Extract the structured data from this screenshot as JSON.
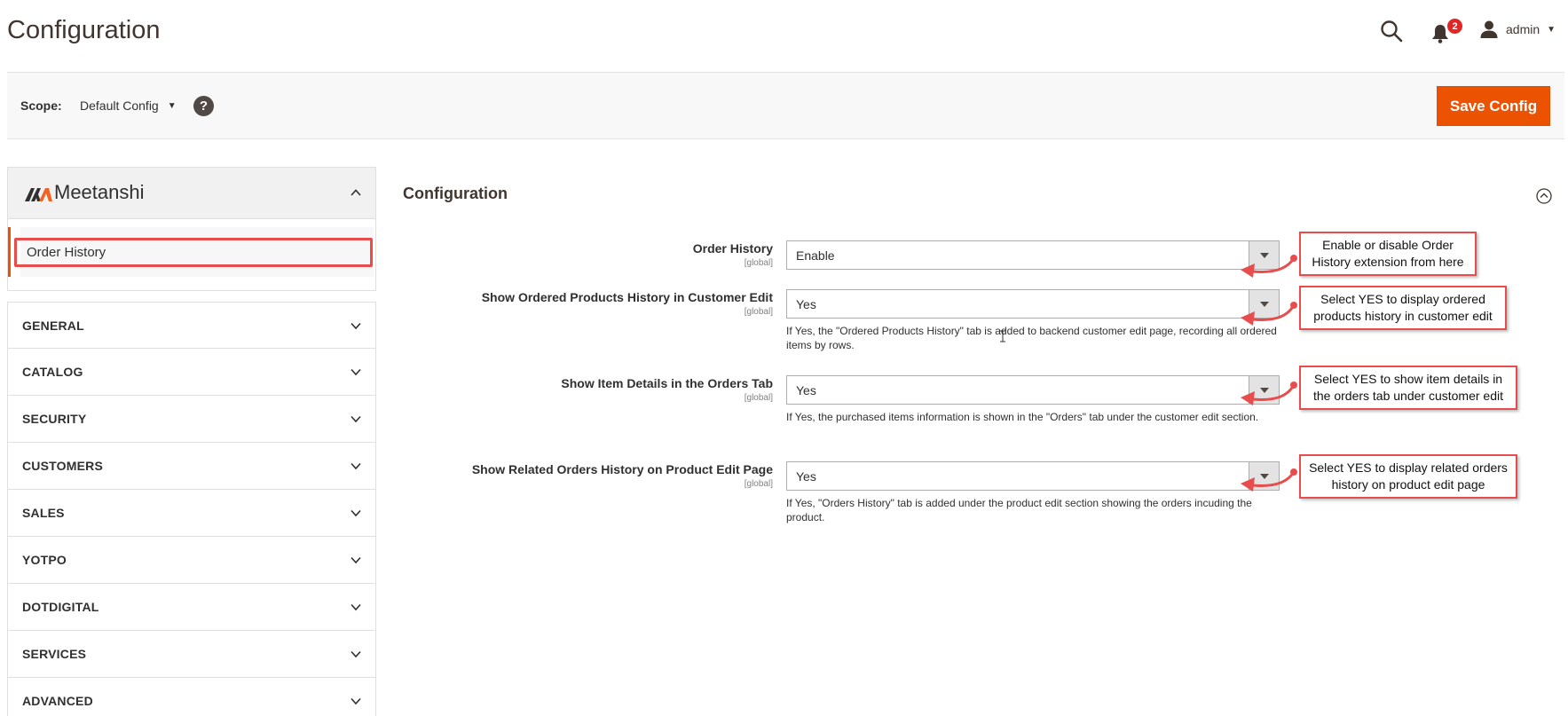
{
  "header": {
    "title": "Configuration",
    "notification_count": "2",
    "user_name": "admin"
  },
  "scope_bar": {
    "label": "Scope:",
    "selected": "Default Config",
    "help": "?",
    "save_label": "Save Config"
  },
  "sidebar": {
    "brand": "Meetanshi",
    "sub_item": "Order History",
    "sections": [
      "GENERAL",
      "CATALOG",
      "SECURITY",
      "CUSTOMERS",
      "SALES",
      "YOTPO",
      "DOTDIGITAL",
      "SERVICES",
      "ADVANCED"
    ]
  },
  "main": {
    "title": "Configuration",
    "fields": [
      {
        "label": "Order History",
        "scope": "[global]",
        "value": "Enable",
        "note": ""
      },
      {
        "label": "Show Ordered Products History in Customer Edit",
        "scope": "[global]",
        "value": "Yes",
        "note": "If Yes, the \"Ordered Products History\" tab is added to backend customer edit page, recording all ordered items by rows."
      },
      {
        "label": "Show Item Details in the Orders Tab",
        "scope": "[global]",
        "value": "Yes",
        "note": "If Yes, the purchased items information is shown in the \"Orders\" tab under the customer edit section."
      },
      {
        "label": "Show Related Orders History on Product Edit Page",
        "scope": "[global]",
        "value": "Yes",
        "note": "If Yes, \"Orders History\" tab is added under the product edit section showing the orders incuding the product."
      }
    ]
  },
  "callouts": [
    "Enable or disable Order History extension from here",
    "Select YES to display ordered products history in customer edit",
    "Select YES to show item details in the orders tab under customer edit",
    "Select YES to display related orders history on product edit page"
  ],
  "colors": {
    "accent": "#eb5202",
    "annotation": "#e84d4d",
    "badge": "#e22626"
  }
}
